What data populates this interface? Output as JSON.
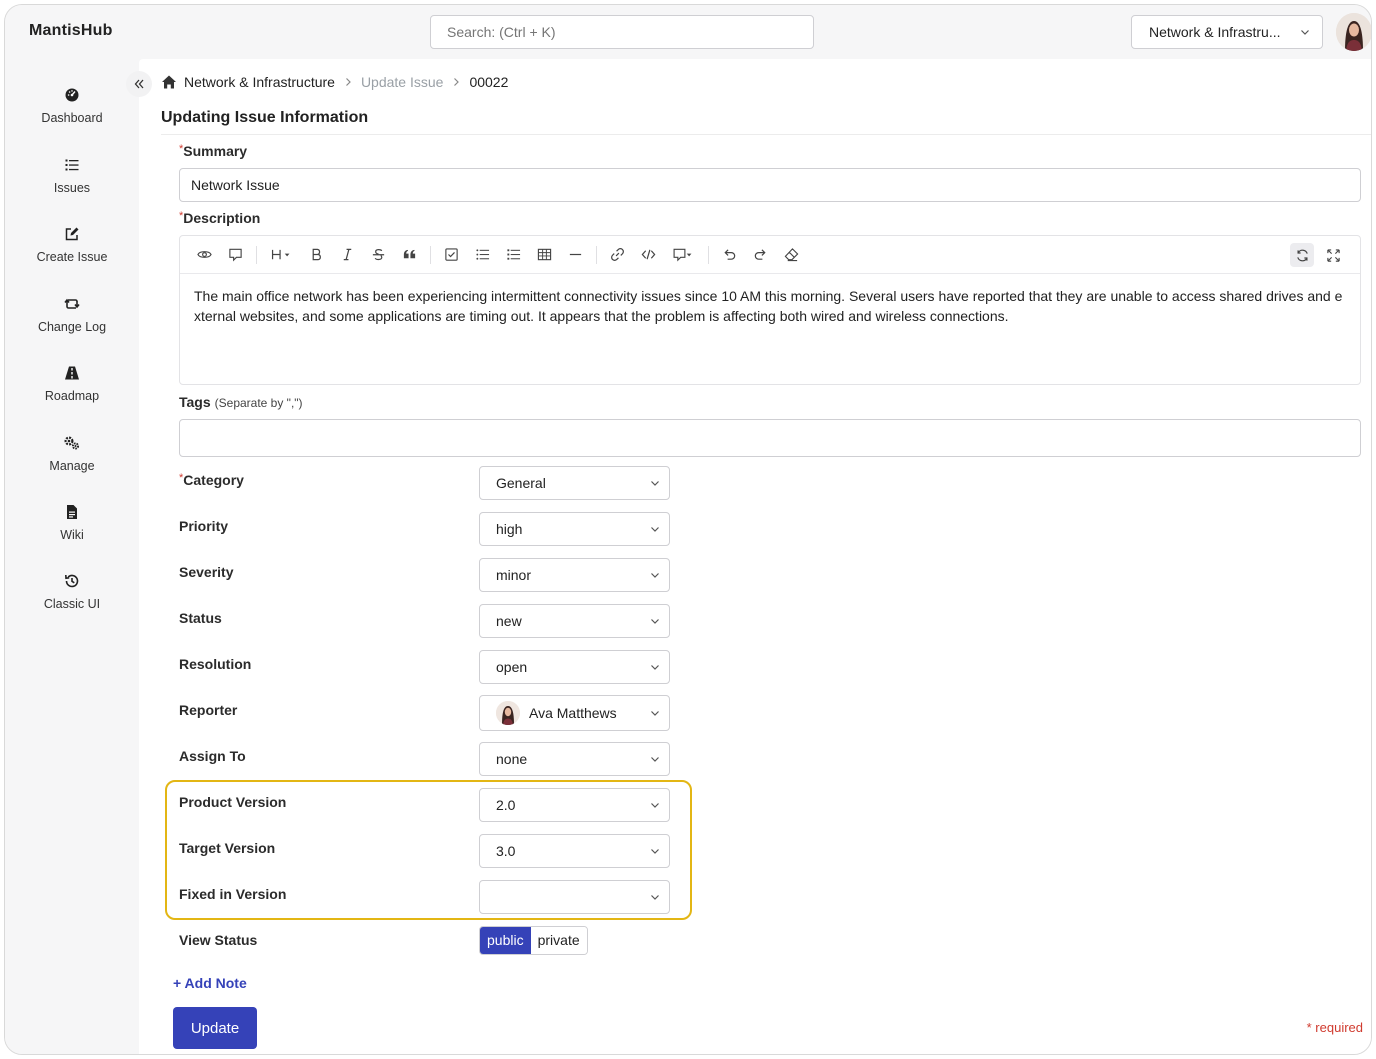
{
  "app": {
    "brand": "MantisHub"
  },
  "search": {
    "placeholder": "Search: (Ctrl + K)"
  },
  "project_selector": {
    "value": "Network & Infrastru..."
  },
  "sidebar": {
    "items": [
      {
        "label": "Dashboard",
        "icon": "dashboard-icon"
      },
      {
        "label": "Issues",
        "icon": "list-icon"
      },
      {
        "label": "Create Issue",
        "icon": "edit-icon"
      },
      {
        "label": "Change Log",
        "icon": "swap-icon"
      },
      {
        "label": "Roadmap",
        "icon": "road-icon"
      },
      {
        "label": "Manage",
        "icon": "gears-icon"
      },
      {
        "label": "Wiki",
        "icon": "file-icon"
      },
      {
        "label": "Classic UI",
        "icon": "history-icon"
      }
    ]
  },
  "breadcrumb": {
    "project": "Network & Infrastructure",
    "page": "Update Issue",
    "issue_id": "00022"
  },
  "page": {
    "title": "Updating Issue Information"
  },
  "form": {
    "summary_label": "Summary",
    "summary_value": "Network Issue",
    "description_label": "Description",
    "description_text": "The main office network has been experiencing intermittent connectivity issues since 10 AM this morning. Several users have reported that they are unable to access shared drives and external websites, and some applications are timing out. It appears that the problem is affecting both wired and wireless connections.",
    "tags_label": "Tags",
    "tags_hint": "(Separate by \",\")",
    "tags_value": "",
    "required_mark": "*",
    "category": {
      "label": "Category",
      "value": "General"
    },
    "priority": {
      "label": "Priority",
      "value": "high"
    },
    "severity": {
      "label": "Severity",
      "value": "minor"
    },
    "status": {
      "label": "Status",
      "value": "new"
    },
    "resolution": {
      "label": "Resolution",
      "value": "open"
    },
    "reporter": {
      "label": "Reporter",
      "value": "Ava Matthews"
    },
    "assign_to": {
      "label": "Assign To",
      "value": "none"
    },
    "product_version": {
      "label": "Product Version",
      "value": "2.0"
    },
    "target_version": {
      "label": "Target Version",
      "value": "3.0"
    },
    "fixed_in_version": {
      "label": "Fixed in Version",
      "value": ""
    },
    "view_status": {
      "label": "View Status",
      "options": [
        "public",
        "private"
      ],
      "selected": "public"
    },
    "add_note": "+ Add Note",
    "update_button": "Update",
    "required_note": "* required"
  },
  "colors": {
    "accent": "#3542b8",
    "highlight": "#e3b614",
    "required": "#d03b2f"
  }
}
